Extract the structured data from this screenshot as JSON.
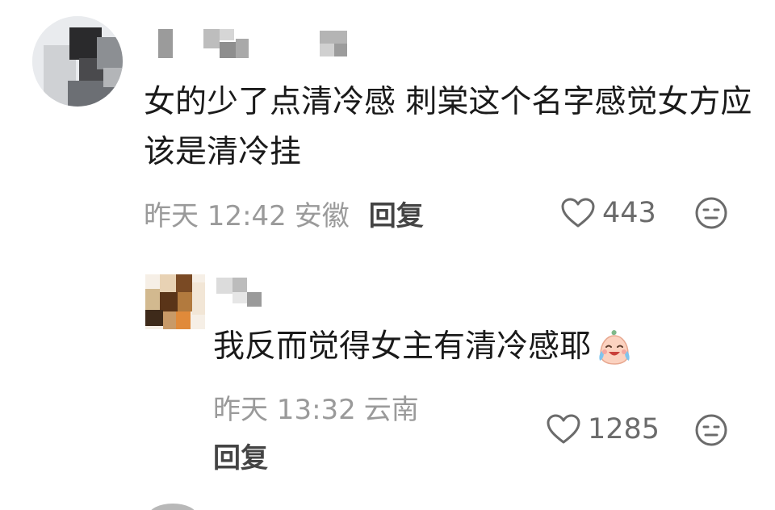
{
  "comment": {
    "text": "女的少了点清冷感 刺棠这个名字感觉女方应该是清冷挂",
    "time": "昨天 12:42",
    "location": "安徽",
    "reply_label": "回复",
    "likes": "443",
    "like_icon": "heart-outline-icon",
    "reaction_icon": "neutral-face-icon"
  },
  "reply": {
    "text": "我反而觉得女主有清冷感耶",
    "emoji": "crying-laughing-face-emoji",
    "time": "昨天 13:32",
    "location": "云南",
    "reply_label": "回复",
    "likes": "1285",
    "like_icon": "heart-outline-icon",
    "reaction_icon": "neutral-face-icon"
  },
  "colors": {
    "text_primary": "#1a1a1a",
    "text_meta": "#9a9a9a",
    "text_action": "#444444",
    "icon": "#6b6b6b",
    "background": "#ffffff"
  }
}
